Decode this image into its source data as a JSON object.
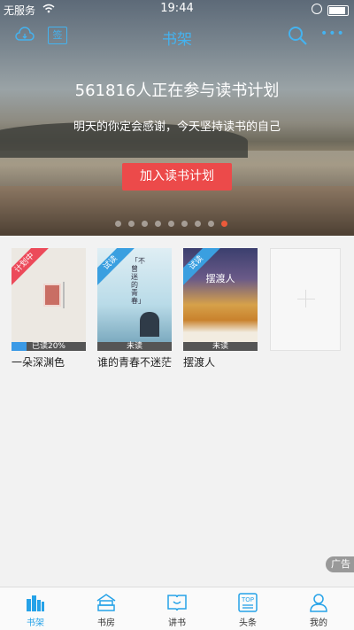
{
  "status_bar": {
    "carrier": "无服务",
    "time": "19:44"
  },
  "nav": {
    "title": "书架",
    "sign_label": "签",
    "more_label": "•••"
  },
  "banner": {
    "count_text": "561816人正在参与读书计划",
    "slogan": "明天的你定会感谢，今天坚持读书的自己",
    "button_label": "加入读书计划",
    "dot_count": 9,
    "active_dot": 8
  },
  "books": [
    {
      "title": "一朵深渊色",
      "badge": "计划中",
      "status": "已读20%",
      "progress": 0.2
    },
    {
      "title": "谁的青春不迷茫",
      "badge": "试读",
      "status": "未读",
      "progress": 0,
      "cover_text": "「不曾迷的青春」"
    },
    {
      "title": "摆渡人",
      "badge": "试读",
      "status": "未读",
      "progress": 0,
      "cover_text": "摆渡人"
    }
  ],
  "ad_label": "广告",
  "tabs": [
    {
      "label": "书架",
      "icon": "bookshelf-icon",
      "active": true
    },
    {
      "label": "书房",
      "icon": "study-room-icon"
    },
    {
      "label": "讲书",
      "icon": "book-talk-icon"
    },
    {
      "label": "头条",
      "icon": "top-news-icon",
      "icon_text": "TOP"
    },
    {
      "label": "我的",
      "icon": "profile-icon"
    }
  ],
  "colors": {
    "accent": "#25a2e8",
    "button": "#ec4a4a",
    "ribbon_plan": "#ec4a5a",
    "ribbon_trial": "#3a9fe0"
  }
}
